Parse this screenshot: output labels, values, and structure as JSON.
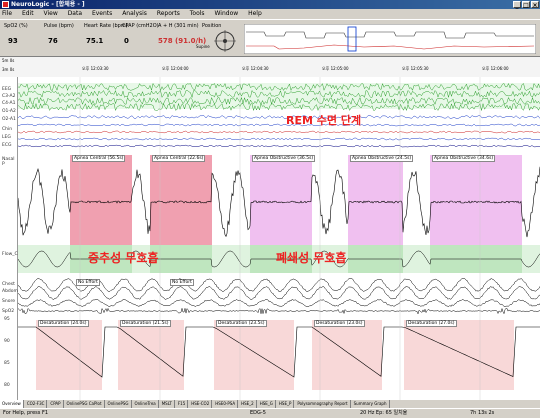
{
  "window": {
    "title": "NeuroLogic - [합체용 - ]",
    "minimize_label": "_",
    "maximize_label": "□",
    "close_label": "×"
  },
  "menu": [
    "File",
    "Edit",
    "View",
    "Data",
    "Events",
    "Analysis",
    "Reports",
    "Tools",
    "Window",
    "Help"
  ],
  "vitals": [
    {
      "label": "SpO2 (%)",
      "value": "93",
      "color": "#000000"
    },
    {
      "label": "Pulse (bpm)",
      "value": "76",
      "color": "#000000"
    },
    {
      "label": "Heart Rate (bpm)",
      "value": "75.1",
      "color": "#000000"
    },
    {
      "label": "CPAP (cmH2O)",
      "value": "0",
      "color": "#000000"
    },
    {
      "label": "A + H (301 min)",
      "value": "578 (91.0/h)",
      "color": "#cc3333"
    },
    {
      "label": "Position",
      "value": "Supine",
      "color": "#000000"
    }
  ],
  "ruler": {
    "top_left": "5m 0s",
    "mid_left": "3m 0s",
    "times": [
      "오후 12:03:30",
      "오후 12:04:00",
      "오후 12:04:30",
      "오후 12:05:00",
      "오후 12:05:30",
      "오후 12:06:00"
    ]
  },
  "channels_top": [
    "EEG",
    "C3-A2",
    "C4-A1",
    "O1-A2",
    "O2-A1",
    "Chin",
    "LEG",
    "ECG"
  ],
  "channels_bottom": [
    "Nasal P",
    "Flow_C3",
    "Chest",
    "Abdomen",
    "Snore",
    "SpO2"
  ],
  "events_apnea": [
    {
      "label": "Apnea Central (56.5s)",
      "type": "central"
    },
    {
      "label": "Apnea Central (22.6s)",
      "type": "central"
    },
    {
      "label": "Apnea Obstructive (36.5s)",
      "type": "obstructive"
    },
    {
      "label": "Apnea Obstructive (24.5s)",
      "type": "obstructive"
    },
    {
      "label": "Apnea Obstructive (34.6s)",
      "type": "obstructive"
    }
  ],
  "events_desat": [
    {
      "label": "Desaturation (24.0s)"
    },
    {
      "label": "Desaturation (21.5s)"
    },
    {
      "label": "Desaturation (23.5s)"
    },
    {
      "label": "Desaturation (23.0s)"
    },
    {
      "label": "Desaturation (27.0s)"
    }
  ],
  "effort_labels": [
    "No Effort",
    "No Effort"
  ],
  "annotations": {
    "rem": "REM 수면 단계",
    "central": "중추성 무호흡",
    "obstructive": "폐쇄성 무호흡"
  },
  "spo2_ticks": [
    "95",
    "90",
    "85",
    "80"
  ],
  "tabs": [
    "Overview",
    "CO2-F3C",
    "CPAP",
    "OnlinePSG CaPlot",
    "OnlinePSG",
    "OnlineTrea",
    "MSLT",
    "F15",
    "HSE-CO2",
    "HSE0-PSA",
    "HSE_2",
    "HSE_G",
    "HSE_P",
    "Polysomnography Report",
    "Summary Graph"
  ],
  "status": {
    "left": "For Help, press F1",
    "center": "EDG-5",
    "right": "20 Hz  Ep: 65  일치율",
    "time": "7h 13s  2s"
  },
  "colors": {
    "central_fill": "#f0a0b0",
    "obstructive_fill": "#f0c0f0",
    "desat_fill": "#f8d8d8",
    "annotation_red": "#ee2222",
    "green_band": "#2fa02f"
  }
}
